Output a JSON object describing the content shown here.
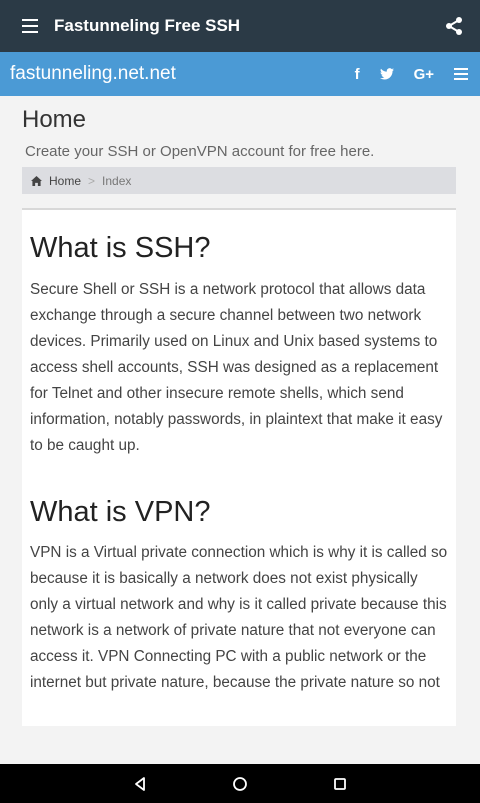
{
  "app": {
    "title": "Fastunneling Free SSH"
  },
  "site": {
    "name": "fastunneling.net.net",
    "social": {
      "facebook": "f",
      "twitter": "🐦",
      "gplus": "G+"
    }
  },
  "header": {
    "title": "Home",
    "subtitle": "Create your SSH or OpenVPN account for free here."
  },
  "breadcrumb": {
    "home": "Home",
    "separator": ">",
    "current": "Index"
  },
  "content": {
    "ssh_heading": "What is SSH?",
    "ssh_text": "Secure Shell or SSH is a network protocol that allows data exchange through a secure channel between two network devices. Primarily used on Linux and Unix based systems to access shell accounts, SSH was designed as a replacement for Telnet and other insecure remote shells, which send information, notably passwords, in plaintext that make it easy to be caught up.",
    "vpn_heading": "What is VPN?",
    "vpn_text": "VPN is a Virtual private connection which is why it is called so because it is basically a network does not exist physically only a virtual network and why is it called private because this network is a network of private nature that not everyone can access it. VPN Connecting PC with a public network or the internet but private nature, because the private nature so not"
  },
  "colors": {
    "appbar": "#2b3a46",
    "sitebar": "#4b9ad5",
    "navbar": "#000000"
  }
}
